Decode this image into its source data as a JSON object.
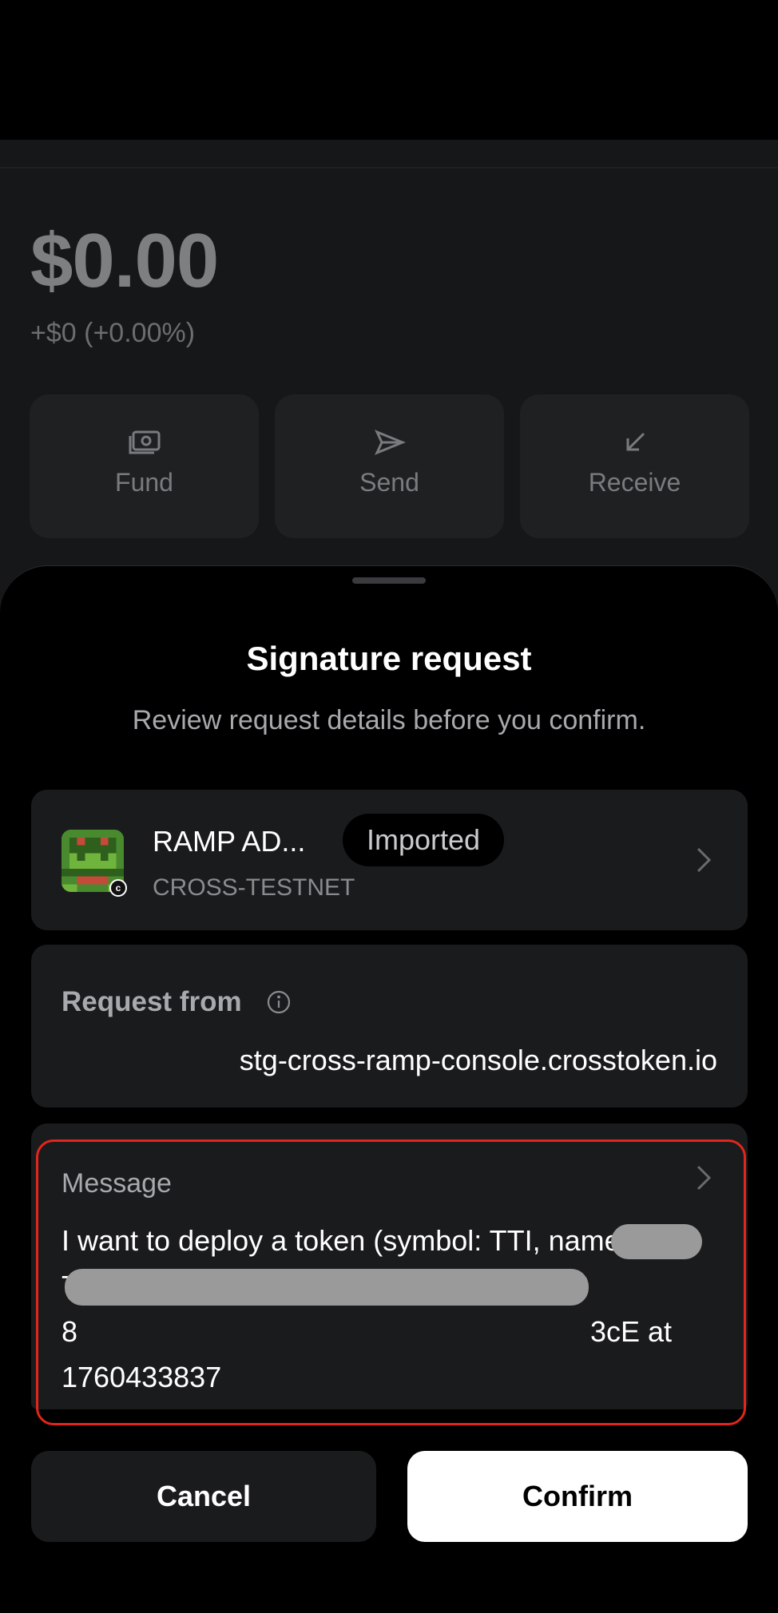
{
  "wallet": {
    "balance": "$0.00",
    "change": "+$0 (+0.00%)",
    "actions": [
      {
        "label": "Fund",
        "icon": "wallet-icon"
      },
      {
        "label": "Send",
        "icon": "send-icon"
      },
      {
        "label": "Receive",
        "icon": "receive-arrow-icon"
      }
    ]
  },
  "sheet": {
    "title": "Signature request",
    "subtitle": "Review request details before you confirm.",
    "account": {
      "name": "RAMP AD...",
      "badge": "Imported",
      "network": "CROSS-TESTNET",
      "avatar_badge": "c"
    },
    "request_from": {
      "label": "Request from",
      "value": "stg-cross-ramp-console.crosstoken.io"
    },
    "message": {
      "label": "Message",
      "line1": "I want to deploy a token (symbol: TTI, name:",
      "line2": "TestTokenI) with the owner set to 0xaAA8",
      "line3_start": "8",
      "line3_end": "3cE at",
      "line4": "1760433837"
    },
    "buttons": {
      "cancel": "Cancel",
      "confirm": "Confirm"
    }
  },
  "colors": {
    "highlight_outline": "#e3251c",
    "confirm_bg": "#ffffff",
    "card_bg": "#1a1b1d"
  }
}
